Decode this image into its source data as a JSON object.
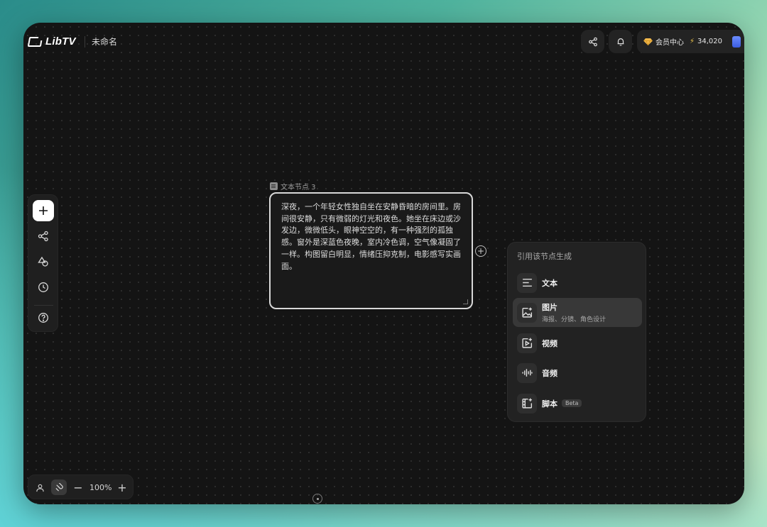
{
  "app": {
    "logo_text": "LibTV",
    "doc_title": "未命名"
  },
  "header": {
    "share_icon": "share-icon",
    "bell_icon": "bell-icon",
    "member_label": "会员中心",
    "credits": "34,020"
  },
  "toolbar": {
    "items": [
      {
        "name": "add",
        "icon": "plus-icon",
        "active": true
      },
      {
        "name": "workflow",
        "icon": "nodes-icon",
        "active": false
      },
      {
        "name": "assets",
        "icon": "shapes-icon",
        "active": false
      },
      {
        "name": "history",
        "icon": "clock-icon",
        "active": false
      },
      {
        "name": "help",
        "icon": "question-icon",
        "active": false
      }
    ]
  },
  "node": {
    "label": "文本节点 3",
    "text": "深夜，一个年轻女性独自坐在安静昏暗的房间里。房间很安静，只有微弱的灯光和夜色。她坐在床边或沙发边，微微低头，眼神空空的，有一种强烈的孤独感。窗外是深蓝色夜晚，室内冷色调，空气像凝固了一样。构图留白明显，情绪压抑克制，电影感写实画面。"
  },
  "menu": {
    "title": "引用该节点生成",
    "items": [
      {
        "label": "文本",
        "sub": "",
        "icon": "text-lines-icon",
        "highlight": false,
        "badge": ""
      },
      {
        "label": "图片",
        "sub": "海报、分镜、角色设计",
        "icon": "image-sparkle-icon",
        "highlight": true,
        "badge": ""
      },
      {
        "label": "视频",
        "sub": "",
        "icon": "video-sparkle-icon",
        "highlight": false,
        "badge": ""
      },
      {
        "label": "音频",
        "sub": "",
        "icon": "audio-wave-icon",
        "highlight": false,
        "badge": ""
      },
      {
        "label": "脚本",
        "sub": "",
        "icon": "film-script-icon",
        "highlight": false,
        "badge": "Beta"
      }
    ]
  },
  "zoom": {
    "value": "100%",
    "minus": "−",
    "plus": "+"
  },
  "colors": {
    "canvas": "#141414",
    "panel": "#222222",
    "accent_gold": "#f2c94c"
  }
}
